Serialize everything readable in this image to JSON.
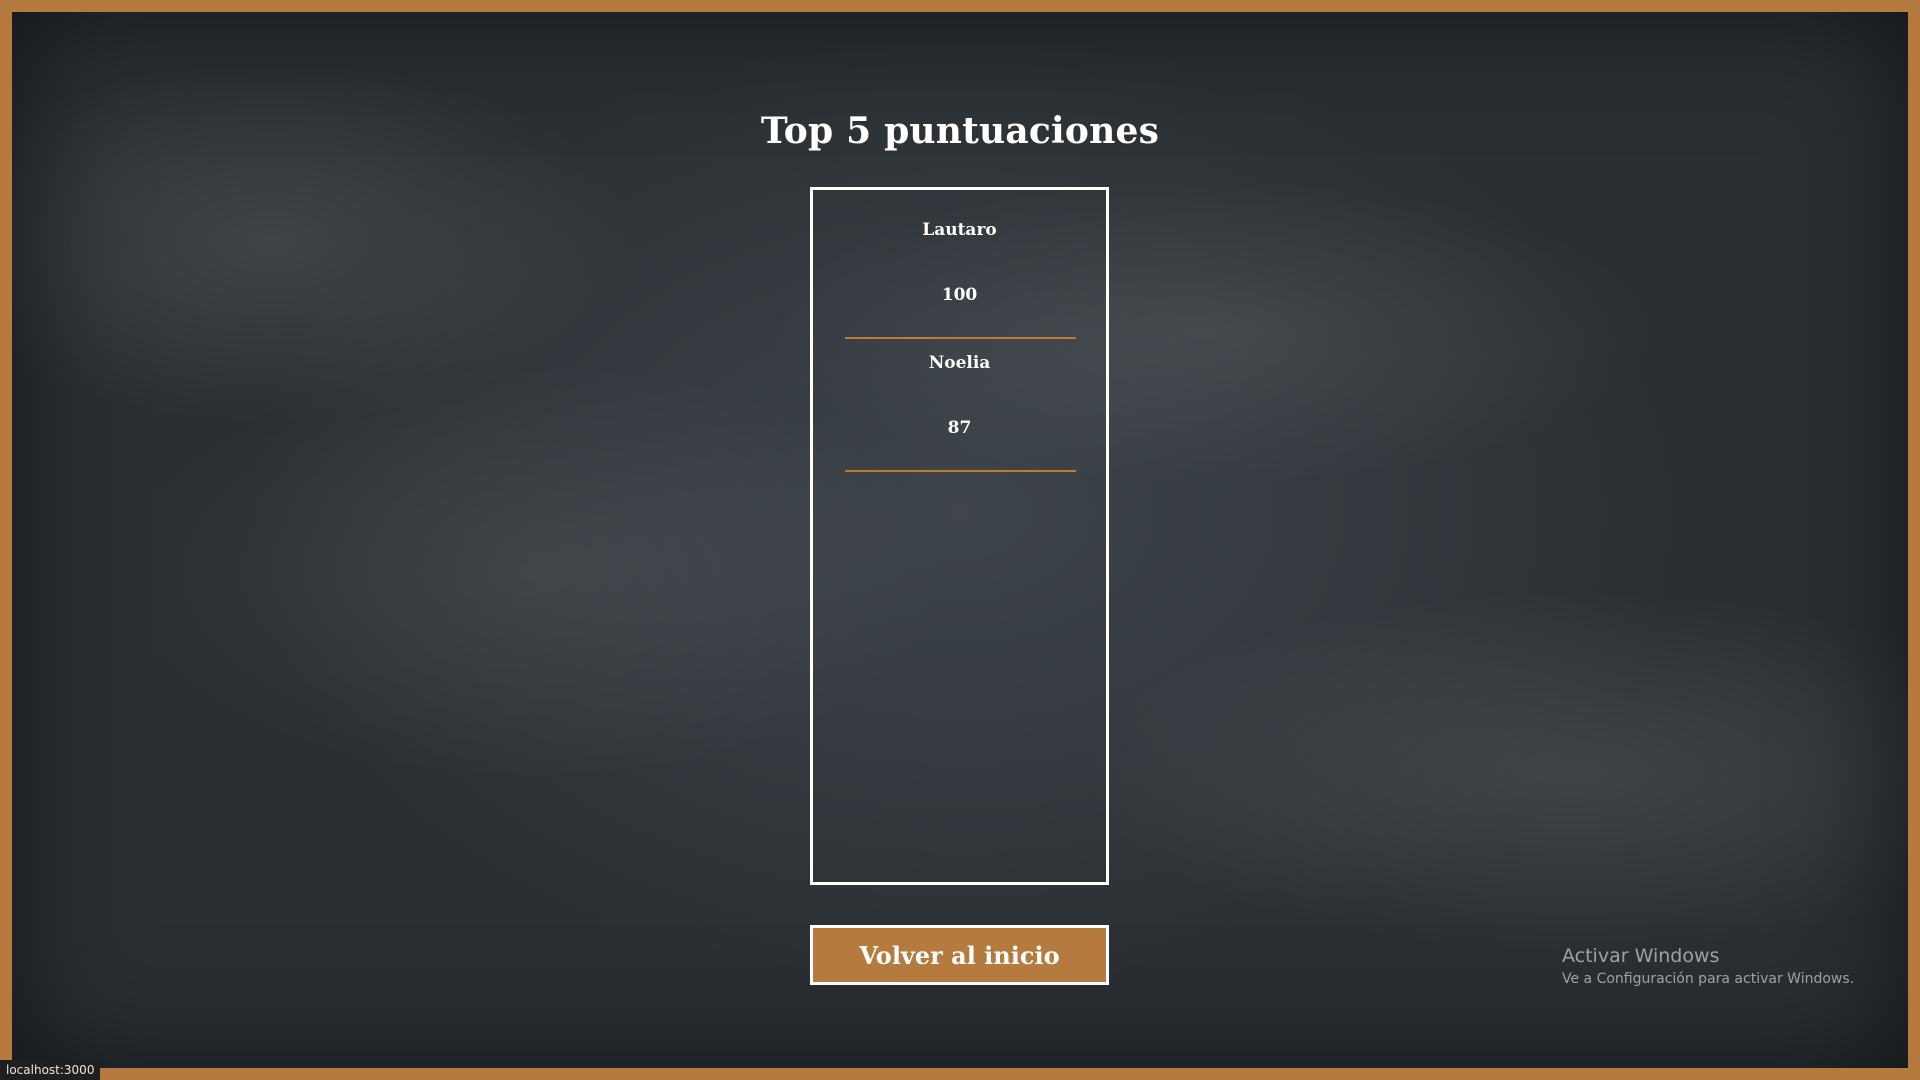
{
  "page": {
    "title": "Top 5 puntuaciones"
  },
  "scores": [
    {
      "name": "Lautaro",
      "points": "100"
    },
    {
      "name": "Noelia",
      "points": "87"
    }
  ],
  "actions": {
    "back_label": "Volver al inicio"
  },
  "watermark": {
    "title": "Activar Windows",
    "subtitle": "Ve a Configuración para activar Windows."
  },
  "status_bar": {
    "url": "localhost:3000"
  },
  "colors": {
    "frame": "#b57a3e",
    "board": "#353b40",
    "accent_line": "#c07b33",
    "text": "#ffffff"
  }
}
